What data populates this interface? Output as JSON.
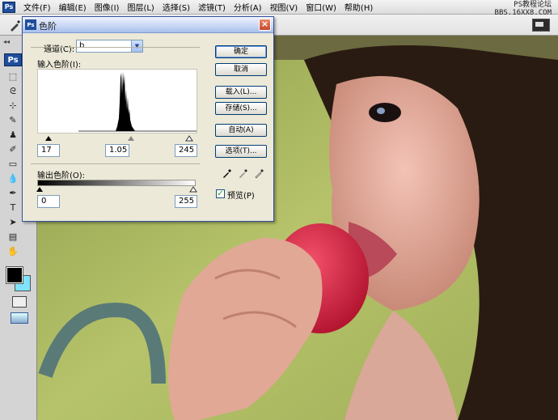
{
  "app": {
    "logo_text": "Ps",
    "menu": [
      "文件(F)",
      "编辑(E)",
      "图像(I)",
      "图层(L)",
      "选择(S)",
      "滤镜(T)",
      "分析(A)",
      "视图(V)",
      "窗口(W)",
      "帮助(H)"
    ],
    "watermark_line1": "PS教程论坛",
    "watermark_line2": "BBS.16XX8.COM"
  },
  "toolbox": {
    "collapse_label": "◂◂",
    "badge": "Ps"
  },
  "dialog": {
    "title": "色阶",
    "channel_label": "通道(C):",
    "channel_value": "b",
    "input_levels_label": "输入色阶(I):",
    "input_black": "17",
    "input_gamma": "1.05",
    "input_white": "245",
    "output_levels_label": "输出色阶(O):",
    "output_black": "0",
    "output_white": "255",
    "buttons": {
      "ok": "确定",
      "cancel": "取消",
      "load": "载入(L)...",
      "save": "存储(S)...",
      "auto": "自动(A)",
      "options": "选项(T)..."
    },
    "preview_label": "预览(P)",
    "preview_checked": true
  },
  "colors": {
    "dialog_bg": "#ece9d8",
    "titlebar": "#c6d5f4",
    "foreground_color": "#000000",
    "background_color": "#7fe3ff"
  }
}
